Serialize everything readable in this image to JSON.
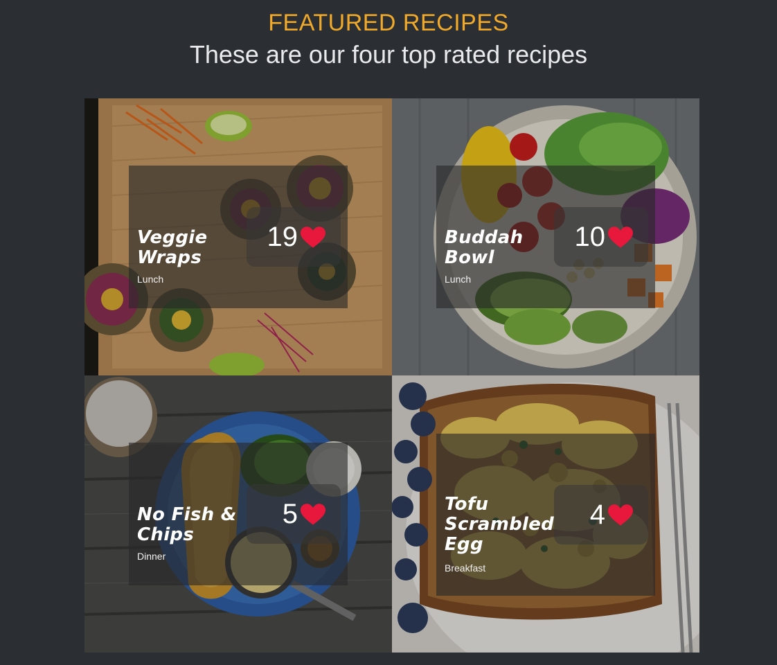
{
  "header": {
    "eyebrow": "FEATURED RECIPES",
    "subtitle": "These are our four top rated recipes"
  },
  "colors": {
    "accent": "#f0a92a",
    "heart": "#e8173c",
    "background": "#2b2f33"
  },
  "recipes": [
    {
      "name": "Veggie Wraps",
      "category": "Lunch",
      "likes": "19",
      "icon": "heart-icon"
    },
    {
      "name": "Buddah Bowl",
      "category": "Lunch",
      "likes": "10",
      "icon": "heart-icon"
    },
    {
      "name": "No Fish & Chips",
      "category": "Dinner",
      "likes": "5",
      "icon": "heart-icon"
    },
    {
      "name": "Tofu Scrambled Egg",
      "category": "Breakfast",
      "likes": "4",
      "icon": "heart-icon"
    }
  ]
}
